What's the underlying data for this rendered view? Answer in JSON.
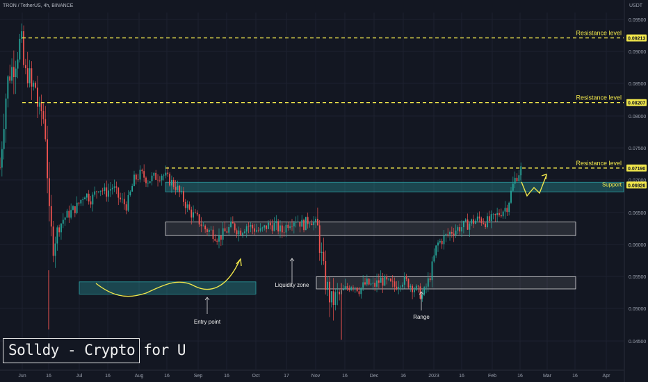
{
  "header": {
    "symbol_title": "TRON / TetherUS, 4h, BINANCE",
    "currency": "USDT"
  },
  "watermark": {
    "text": "Solldy - Crypto for U"
  },
  "colors": {
    "background": "#131722",
    "candle_up": "#26a69a",
    "candle_down": "#ef5350",
    "annotation": "#f0e64b",
    "zone_teal": "#2b9fa3",
    "zone_gray": "#c8c8c8",
    "price_tag_bg": "#f0e64b",
    "axis_text": "#9aa0ad"
  },
  "chart_data": {
    "type": "candlestick",
    "title": "TRON / TetherUS, 4h, BINANCE",
    "x_ticks": [
      "Jun",
      "16",
      "Jul",
      "16",
      "Aug",
      "16",
      "Sep",
      "16",
      "Oct",
      "17",
      "Nov",
      "16",
      "Dec",
      "16",
      "2023",
      "16",
      "Feb",
      "16",
      "Mar",
      "16",
      "Apr"
    ],
    "y_ticks": [
      "0.09500",
      "0.09000",
      "0.08500",
      "0.08000",
      "0.07500",
      "0.07000",
      "0.06500",
      "0.06000",
      "0.05500",
      "0.05000",
      "0.04500"
    ],
    "ylim": [
      0.044,
      0.0962
    ],
    "y_unit": "USDT",
    "price_tags": [
      {
        "label": "0.09213",
        "value": 0.09213
      },
      {
        "label": "0.08207",
        "value": 0.08207
      },
      {
        "label": "0.07190",
        "value": 0.0719
      },
      {
        "label": "0.06926",
        "value": 0.06926
      }
    ],
    "horizontal_levels": [
      {
        "label": "Resistance level",
        "value": 0.09213
      },
      {
        "label": "Resistance level",
        "value": 0.08207
      },
      {
        "label": "Resistance level",
        "value": 0.0719
      }
    ],
    "zones": [
      {
        "label": "Support",
        "style": "teal",
        "top": 0.0697,
        "bottom": 0.0682
      },
      {
        "label": "",
        "style": "gray",
        "top": 0.0635,
        "bottom": 0.0614
      },
      {
        "label": "",
        "style": "gray",
        "top": 0.055,
        "bottom": 0.0531
      },
      {
        "label": "",
        "style": "teal",
        "top": 0.0542,
        "bottom": 0.0523
      }
    ],
    "annotations": [
      "Liquidity zone",
      "Entry point",
      "Range",
      "Support"
    ],
    "price_path": [
      [
        0.0,
        0.072
      ],
      [
        0.5,
        0.079
      ],
      [
        1.0,
        0.085
      ],
      [
        1.5,
        0.087
      ],
      [
        2.0,
        0.088
      ],
      [
        2.5,
        0.09
      ],
      [
        3.0,
        0.0921
      ],
      [
        3.5,
        0.086
      ],
      [
        4.0,
        0.087
      ],
      [
        4.5,
        0.084
      ],
      [
        5.0,
        0.085
      ],
      [
        5.5,
        0.08
      ],
      [
        6.0,
        0.081
      ],
      [
        6.5,
        0.077
      ],
      [
        7.0,
        0.064
      ],
      [
        7.5,
        0.06
      ],
      [
        8.0,
        0.062
      ],
      [
        9.0,
        0.064
      ],
      [
        10.0,
        0.065
      ],
      [
        11.0,
        0.066
      ],
      [
        12.0,
        0.068
      ],
      [
        13.0,
        0.067
      ],
      [
        14.0,
        0.069
      ],
      [
        15.0,
        0.068
      ],
      [
        16.0,
        0.069
      ],
      [
        17.0,
        0.067
      ],
      [
        18.0,
        0.066
      ],
      [
        19.0,
        0.07
      ],
      [
        20.0,
        0.071
      ],
      [
        21.0,
        0.07
      ],
      [
        22.0,
        0.0705
      ],
      [
        23.0,
        0.071
      ],
      [
        24.0,
        0.07
      ],
      [
        25.0,
        0.069
      ],
      [
        26.0,
        0.067
      ],
      [
        27.0,
        0.065
      ],
      [
        28.0,
        0.064
      ],
      [
        29.0,
        0.0625
      ],
      [
        30.0,
        0.062
      ],
      [
        31.0,
        0.061
      ],
      [
        32.0,
        0.062
      ],
      [
        33.0,
        0.063
      ],
      [
        34.0,
        0.062
      ],
      [
        35.0,
        0.063
      ],
      [
        36.0,
        0.0625
      ],
      [
        37.0,
        0.062
      ],
      [
        38.0,
        0.063
      ],
      [
        39.0,
        0.063
      ],
      [
        40.0,
        0.062
      ],
      [
        41.0,
        0.0635
      ],
      [
        42.0,
        0.064
      ],
      [
        43.0,
        0.063
      ],
      [
        44.0,
        0.064
      ],
      [
        45.0,
        0.063
      ],
      [
        46.0,
        0.055
      ],
      [
        47.0,
        0.051
      ],
      [
        48.0,
        0.052
      ],
      [
        49.0,
        0.053
      ],
      [
        50.0,
        0.054
      ],
      [
        51.0,
        0.053
      ],
      [
        52.0,
        0.054
      ],
      [
        53.0,
        0.0535
      ],
      [
        54.0,
        0.0545
      ],
      [
        55.0,
        0.054
      ],
      [
        56.0,
        0.0535
      ],
      [
        57.0,
        0.0545
      ],
      [
        58.0,
        0.054
      ],
      [
        59.0,
        0.053
      ],
      [
        60.0,
        0.052
      ],
      [
        61.0,
        0.055
      ],
      [
        62.0,
        0.06
      ],
      [
        63.0,
        0.061
      ],
      [
        64.0,
        0.062
      ],
      [
        65.0,
        0.0625
      ],
      [
        66.0,
        0.063
      ],
      [
        67.0,
        0.0635
      ],
      [
        68.0,
        0.064
      ],
      [
        69.0,
        0.0635
      ],
      [
        70.0,
        0.064
      ],
      [
        71.0,
        0.065
      ],
      [
        72.0,
        0.066
      ],
      [
        73.0,
        0.07
      ],
      [
        74.0,
        0.0719
      ]
    ]
  }
}
